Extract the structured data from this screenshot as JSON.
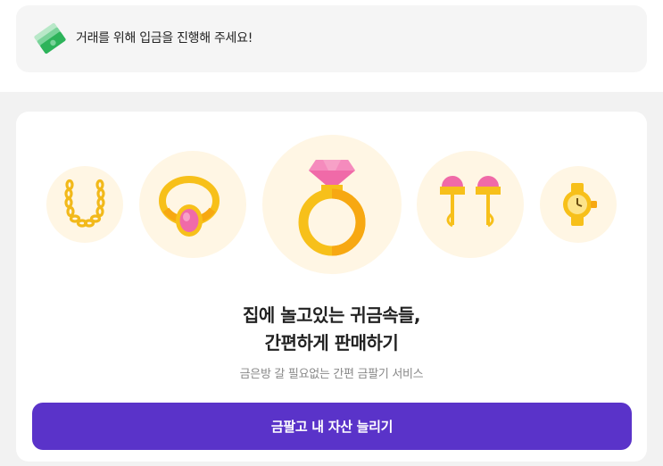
{
  "notice": {
    "icon": "money-bills-icon",
    "text": "거래를 위해 입금을 진행해 주세요!"
  },
  "hero": {
    "items": [
      {
        "icon": "gold-chain-necklace-icon"
      },
      {
        "icon": "gold-ring-pink-gem-icon"
      },
      {
        "icon": "gold-diamond-ring-icon"
      },
      {
        "icon": "gold-earrings-icon"
      },
      {
        "icon": "gold-watch-icon"
      }
    ],
    "headline_line1": "집에 놀고있는 귀금속들,",
    "headline_line2": "간편하게 판매하기",
    "subtitle": "금은방 갈 필요없는 간편 금팔기 서비스",
    "cta_label": "금팔고 내 자산 늘리기"
  },
  "colors": {
    "accent": "#5a33c9",
    "gold": "#f7c01a",
    "pink": "#f06aa8",
    "circle_bg": "#fff6e4"
  }
}
